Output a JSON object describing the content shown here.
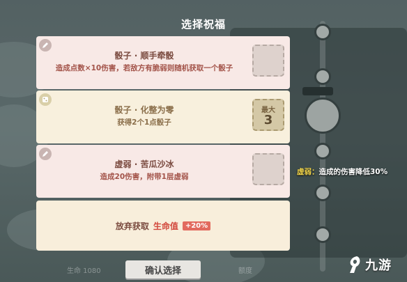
{
  "title": "选择祝福",
  "cards": [
    {
      "name": "骰子 · 顺手牵骰",
      "desc": "造成点数×10伤害，若敌方有脆弱则随机获取一个骰子",
      "icon": "pencil-icon"
    },
    {
      "name": "骰子 · 化整为零",
      "desc": "获得2个1点骰子",
      "icon": "dice-icon",
      "max_label": "最大",
      "max_value": "3"
    },
    {
      "name": "虚弱 · 苦瓜沙冰",
      "desc": "造成20伤害，附带1层虚弱",
      "icon": "pencil-icon"
    }
  ],
  "abandon": {
    "text": "放弃获取",
    "hp_label": "生命值",
    "hp_bonus": "+20%"
  },
  "confirm_label": "确认选择",
  "side_note": {
    "key": "虚弱：",
    "text": "造成的伤害降低30%"
  },
  "footer": {
    "hp": "生命 1080",
    "right": "额度"
  },
  "logo_text": "九游",
  "colors": {
    "accent_red": "#d2483c",
    "pink_card": "#f8e9e6",
    "cream_card": "#f8f0dd"
  }
}
